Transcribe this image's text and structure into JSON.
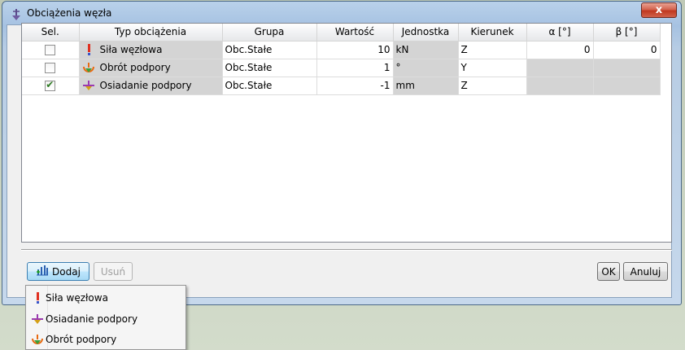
{
  "window": {
    "title": "Obciążenia węzła",
    "close_label": "x"
  },
  "table": {
    "columns": [
      "Sel.",
      "Typ obciążenia",
      "Grupa",
      "Wartość",
      "Jednostka",
      "Kierunek",
      "α [°]",
      "β [°]"
    ],
    "rows": [
      {
        "selected": false,
        "type": "Siła węzłowa",
        "icon": "force-icon",
        "group": "Obc.Stałe",
        "value": "10",
        "unit": "kN",
        "direction": "Z",
        "alpha": "0",
        "beta": "0"
      },
      {
        "selected": false,
        "type": "Obrót podpory",
        "icon": "support-rotation-icon",
        "group": "Obc.Stałe",
        "value": "1",
        "unit": "°",
        "direction": "Y",
        "alpha": "",
        "beta": ""
      },
      {
        "selected": true,
        "type": "Osiadanie podpory",
        "icon": "support-settlement-icon",
        "group": "Obc.Stałe",
        "value": "-1",
        "unit": "mm",
        "direction": "Z",
        "alpha": "",
        "beta": ""
      }
    ]
  },
  "buttons": {
    "add": "Dodaj",
    "remove": "Usuń",
    "ok": "OK",
    "cancel": "Anuluj"
  },
  "menu": {
    "items": [
      {
        "label": "Siła węzłowa",
        "icon": "force-icon"
      },
      {
        "label": "Osiadanie podpory",
        "icon": "support-settlement-icon"
      },
      {
        "label": "Obrót podpory",
        "icon": "support-rotation-icon"
      }
    ]
  },
  "colors": {
    "grey_cell": "#d4d4d4",
    "force_red": "#e03020",
    "settlement_purple": "#9b3ab0",
    "rotation_orange": "#e86a12",
    "check_green": "#2d7a22"
  }
}
